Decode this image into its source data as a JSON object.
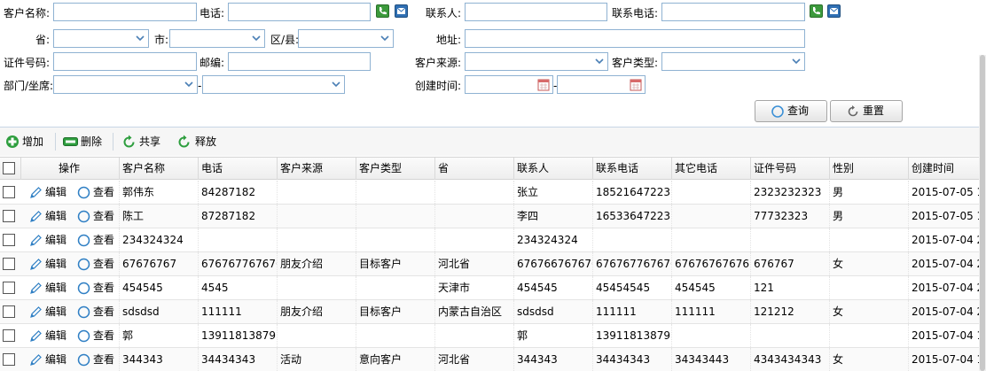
{
  "form": {
    "customer_name_label": "客户名称:",
    "phone_label": "电话:",
    "contact_label": "联系人:",
    "contact_phone_label": "联系电话:",
    "province_label": "省:",
    "city_label": "市:",
    "district_label": "区/县:",
    "address_label": "地址:",
    "id_number_label": "证件号码:",
    "postcode_label": "邮编:",
    "source_label": "客户来源:",
    "type_label": "客户类型:",
    "dept_label": "部门/坐席:",
    "dash": "-",
    "created_label": "创建时间:",
    "dash2": "-",
    "search_button": "查询",
    "reset_button": "重置"
  },
  "toolbar": {
    "add": "增加",
    "delete": "删除",
    "share": "共享",
    "release": "释放"
  },
  "grid": {
    "headers": {
      "op": "操作",
      "name": "客户名称",
      "phone": "电话",
      "source": "客户来源",
      "type": "客户类型",
      "province": "省",
      "contact": "联系人",
      "contact_phone": "联系电话",
      "other_phone": "其它电话",
      "id_number": "证件号码",
      "gender": "性别",
      "created": "创建时间"
    },
    "edit_label": "编辑",
    "view_label": "查看",
    "rows": [
      {
        "name": "郭伟东",
        "phone": "84287182",
        "source": "",
        "type": "",
        "province": "",
        "contact": "张立",
        "contact_phone": "18521647223",
        "other_phone": "",
        "id_number": "2323232323",
        "gender": "男",
        "created": "2015-07-05 1"
      },
      {
        "name": "陈工",
        "phone": "87287182",
        "source": "",
        "type": "",
        "province": "",
        "contact": "李四",
        "contact_phone": "16533647223",
        "other_phone": "",
        "id_number": "77732323",
        "gender": "男",
        "created": "2015-07-05 1"
      },
      {
        "name": "234324324",
        "phone": "",
        "source": "",
        "type": "",
        "province": "",
        "contact": "234324324",
        "contact_phone": "",
        "other_phone": "",
        "id_number": "",
        "gender": "",
        "created": "2015-07-04 2"
      },
      {
        "name": "67676767",
        "phone": "6767677676767",
        "source": "朋友介绍",
        "type": "目标客户",
        "province": "河北省",
        "contact": "6767667676767",
        "contact_phone": "6767677676767",
        "other_phone": "676767676767",
        "id_number": "676767",
        "gender": "女",
        "created": "2015-07-04 2"
      },
      {
        "name": "454545",
        "phone": "4545",
        "source": "",
        "type": "",
        "province": "天津市",
        "contact": "454545",
        "contact_phone": "45454545",
        "other_phone": "454545",
        "id_number": "121",
        "gender": "",
        "created": "2015-07-04 2"
      },
      {
        "name": "sdsdsd",
        "phone": "111111",
        "source": "朋友介绍",
        "type": "目标客户",
        "province": "内蒙古自治区",
        "contact": "sdsdsd",
        "contact_phone": "111111",
        "other_phone": "111111",
        "id_number": "121212",
        "gender": "女",
        "created": "2015-07-04 2"
      },
      {
        "name": "郭",
        "phone": "13911813879",
        "source": "",
        "type": "",
        "province": "",
        "contact": "郭",
        "contact_phone": "13911813879",
        "other_phone": "",
        "id_number": "",
        "gender": "",
        "created": "2015-07-04 1"
      },
      {
        "name": "344343",
        "phone": "34434343",
        "source": "活动",
        "type": "意向客户",
        "province": "河北省",
        "contact": "344343",
        "contact_phone": "34434343",
        "other_phone": "34343443",
        "id_number": "4343434343",
        "gender": "女",
        "created": "2015-07-04 1"
      }
    ]
  },
  "colors": {
    "input_border": "#8fb2d2",
    "toolbar_bg": "#f6f6f6",
    "add_icon": "#2e9e3e",
    "delete_icon": "#2e9e3e",
    "share_icon": "#2e9e3e",
    "edit_icon": "#2f7fc4",
    "view_icon": "#2f7fc4"
  }
}
